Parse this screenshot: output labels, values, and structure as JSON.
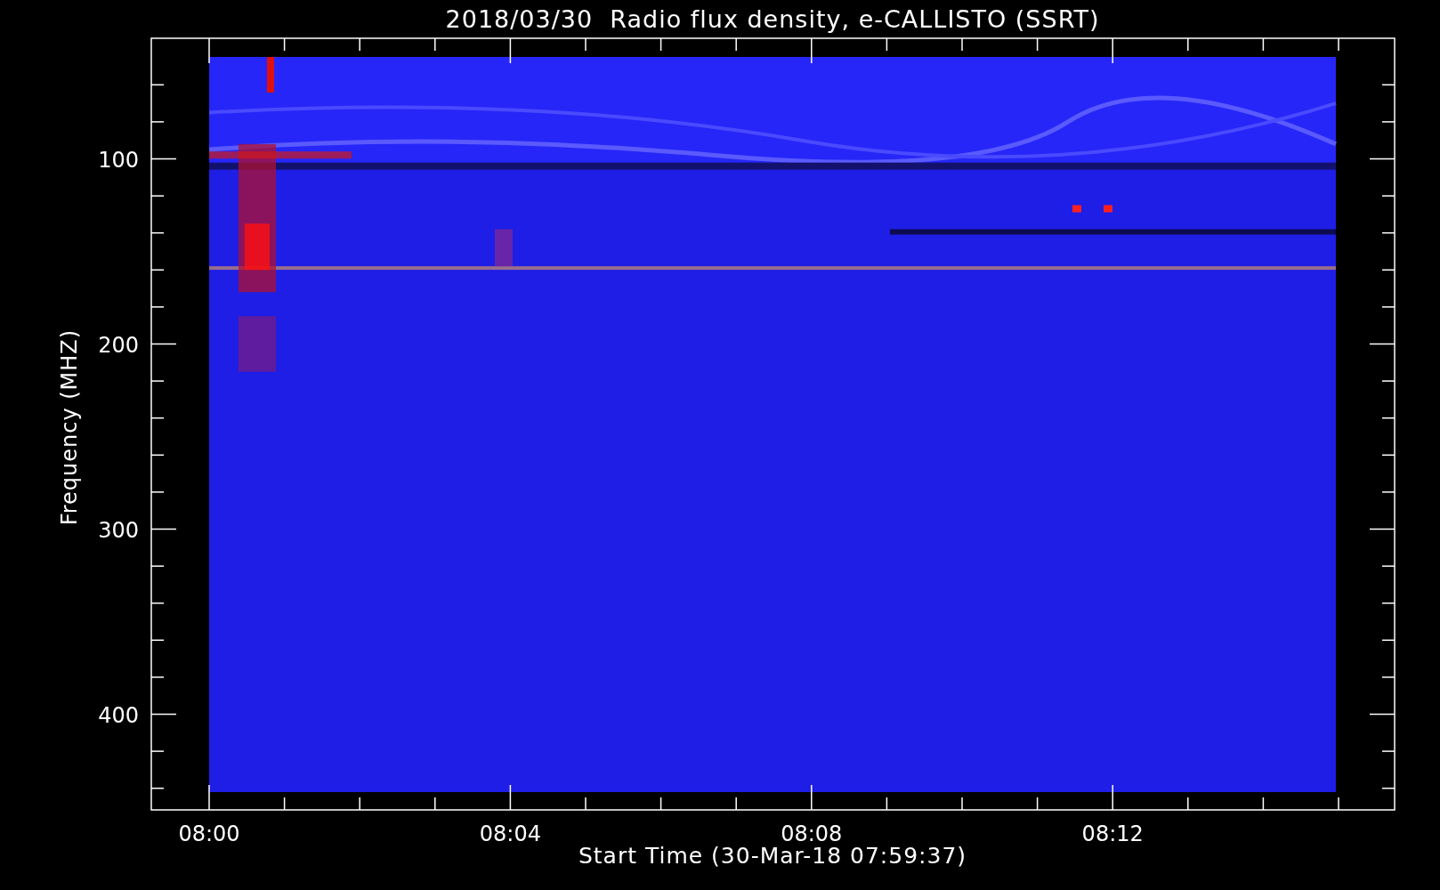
{
  "title": "2018/03/30  Radio flux density, e-CALLISTO (SSRT)",
  "y_axis": {
    "label": "Frequency (MHZ)",
    "ticks": [
      {
        "label": "100"
      },
      {
        "label": "200"
      },
      {
        "label": "300"
      },
      {
        "label": "400"
      }
    ]
  },
  "x_axis": {
    "label": "Start Time (30-Mar-18 07:59:37)",
    "ticks": [
      {
        "label": "08:00"
      },
      {
        "label": "08:04"
      },
      {
        "label": "08:08"
      },
      {
        "label": "08:12"
      }
    ]
  }
}
